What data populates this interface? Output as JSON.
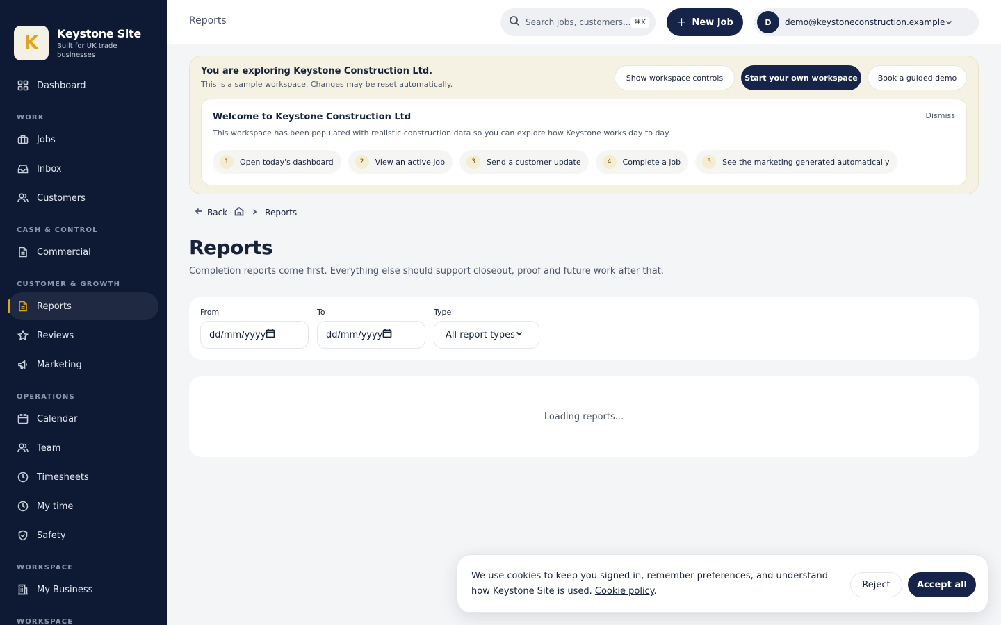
{
  "brand": {
    "name": "Keystone Site",
    "tagline": "Built for UK trade businesses",
    "logo_letter": "K",
    "accent": "#e0a51e"
  },
  "sidebar": {
    "dashboard": "Dashboard",
    "sections": {
      "work": "WORK",
      "cash": "CASH & CONTROL",
      "growth": "CUSTOMER & GROWTH",
      "operations": "OPERATIONS",
      "workspace": "WORKSPACE",
      "workspace2": "WORKSPACE"
    },
    "items": {
      "jobs": "Jobs",
      "inbox": "Inbox",
      "customers": "Customers",
      "commercial": "Commercial",
      "reports": "Reports",
      "reviews": "Reviews",
      "marketing": "Marketing",
      "calendar": "Calendar",
      "team": "Team",
      "timesheets": "Timesheets",
      "my_time": "My time",
      "safety": "Safety",
      "my_business": "My Business"
    }
  },
  "topbar": {
    "title": "Reports",
    "search_placeholder": "Search jobs, customers...",
    "search_shortcut": "⌘K",
    "new_job": "New Job",
    "user_initial": "D",
    "user_email": "demo@keystoneconstruction.example"
  },
  "banner": {
    "title": "You are exploring Keystone Construction Ltd.",
    "subtitle": "This is a sample workspace. Changes may be reset automatically.",
    "btn_controls": "Show workspace controls",
    "btn_start": "Start your own workspace",
    "btn_demo": "Book a guided demo",
    "welcome_title": "Welcome to Keystone Construction Ltd",
    "welcome_sub": "This workspace has been populated with realistic construction data so you can explore how Keystone works day to day.",
    "dismiss": "Dismiss",
    "steps": [
      {
        "num": "1",
        "label": "Open today's dashboard"
      },
      {
        "num": "2",
        "label": "View an active job"
      },
      {
        "num": "3",
        "label": "Send a customer update"
      },
      {
        "num": "4",
        "label": "Complete a job"
      },
      {
        "num": "5",
        "label": "See the marketing generated automatically"
      }
    ]
  },
  "breadcrumb": {
    "back": "Back",
    "current": "Reports"
  },
  "page": {
    "title": "Reports",
    "subtitle": "Completion reports come first. Everything else should support closeout, proof and future work after that."
  },
  "filters": {
    "from_label": "From",
    "from_value": "dd/mm/yyyy",
    "to_label": "To",
    "to_value": "dd/mm/yyyy",
    "type_label": "Type",
    "type_value": "All report types"
  },
  "loading": "Loading reports...",
  "cookie": {
    "text": "We use cookies to keep you signed in, remember preferences, and understand how Keystone Site is used.",
    "link": "Cookie policy",
    "reject": "Reject",
    "accept": "Accept all"
  }
}
